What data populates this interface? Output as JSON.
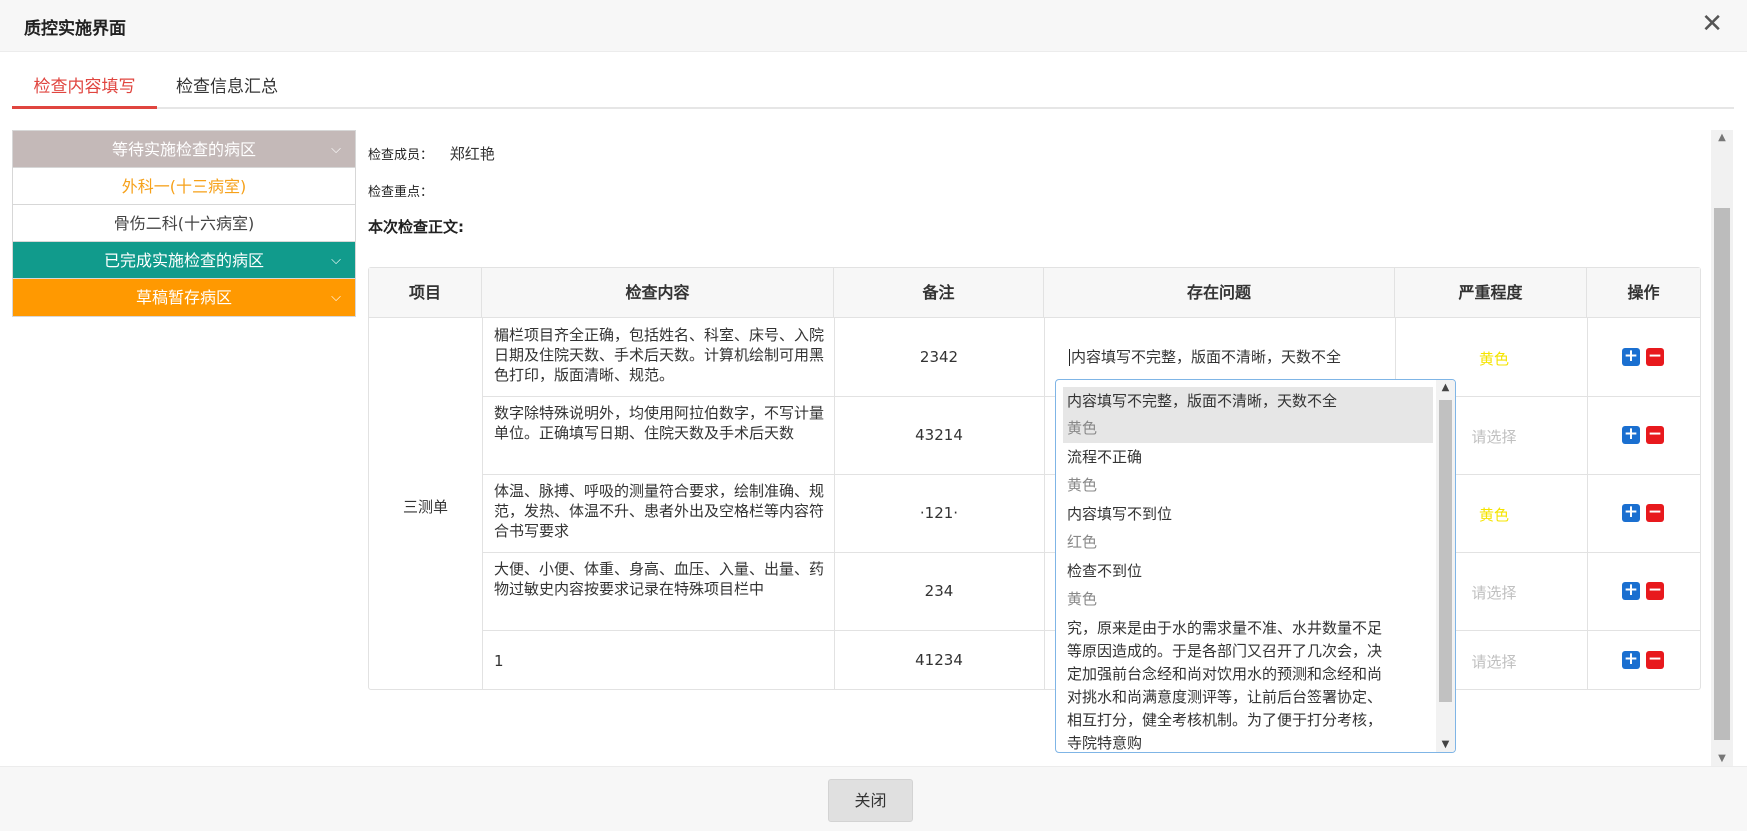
{
  "dialog": {
    "title": "质控实施界面",
    "close_symbol": "✕"
  },
  "tabs": [
    {
      "label": "检查内容填写",
      "active": true
    },
    {
      "label": "检查信息汇总",
      "active": false
    }
  ],
  "sidebar": {
    "waiting_header": "等待实施检查的病区",
    "waiting_items": [
      "外科一(十三病室)",
      "骨伤二科(十六病室)"
    ],
    "completed_header": "已完成实施检查的病区",
    "draft_header": "草稿暂存病区",
    "chevron": "⌵"
  },
  "info": {
    "member_label": "检查成员：",
    "member_value": "郑红艳",
    "focus_label": "检查重点：",
    "body_label": "本次检查正文:"
  },
  "table": {
    "headers": [
      "项目",
      "检查内容",
      "备注",
      "存在问题",
      "严重程度",
      "操作"
    ],
    "item_name": "三测单",
    "rows": [
      {
        "content": "楣栏项目齐全正确，包括姓名、科室、床号、入院日期及住院天数、手术后天数。计算机绘制可用黑色打印，版面清晰、规范。",
        "note": "2342",
        "problem": "内容填写不完整，版面不清晰，天数不全",
        "severity": "黄色"
      },
      {
        "content": "数字除特殊说明外，均使用阿拉伯数字，不写计量单位。正确填写日期、住院天数及手术后天数",
        "note": "43214",
        "problem": "",
        "severity": "请选择"
      },
      {
        "content": "体温、脉搏、呼吸的测量符合要求，绘制准确、规范，发热、体温不升、患者外出及空格栏等内容符合书写要求",
        "note": "·121·",
        "problem": "",
        "severity": "黄色"
      },
      {
        "content": "大便、小便、体重、身高、血压、入量、出量、药物过敏史内容按要求记录在特殊项目栏中",
        "note": "234",
        "problem": "",
        "severity": "请选择"
      },
      {
        "content": "1",
        "note": "41234",
        "problem": "",
        "severity": "请选择"
      }
    ],
    "add_symbol": "+",
    "remove_symbol": "−"
  },
  "dropdown": {
    "options": [
      {
        "text": "内容填写不完整，版面不清晰，天数不全",
        "severity": "黄色"
      },
      {
        "text": "流程不正确",
        "severity": "黄色"
      },
      {
        "text": "内容填写不到位",
        "severity": "红色"
      },
      {
        "text": "检查不到位",
        "severity": "黄色"
      }
    ],
    "long_text": [
      "究，原来是由于水的需求量不准、水井数量不足",
      "等原因造成的。于是各部门又召开了几次会，决",
      "定加强前台念经和尚对饮用水的预测和念经和尚",
      "对挑水和尚满意度测评等，让前后台签署协定、",
      "相互打分，健全考核机制。为了便于打分考核，",
      "寺院特意购"
    ]
  },
  "footer": {
    "close_label": "关闭"
  },
  "colors": {
    "accent_red": "#e0453f",
    "teal": "#119b8c",
    "orange": "#ff9901",
    "selected_text": "#f6a11a",
    "severity_yellow": "#f5e400"
  }
}
